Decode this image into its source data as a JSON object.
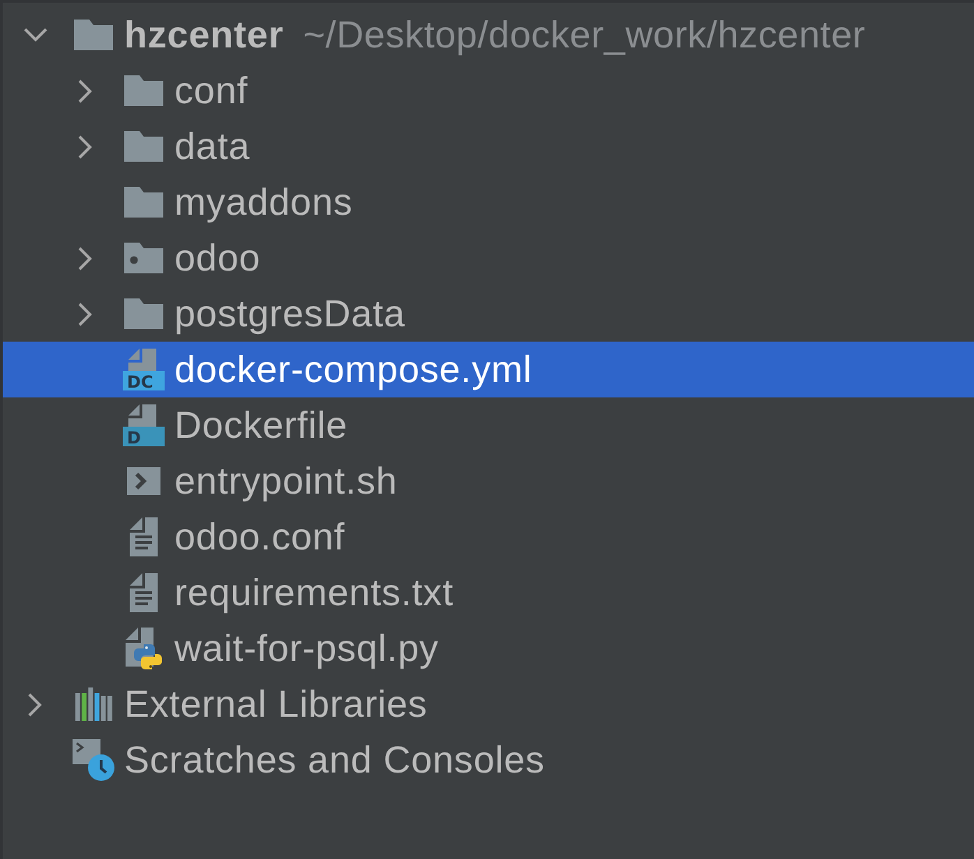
{
  "project_tree": {
    "items": [
      {
        "kind": "project",
        "name": "hzcenter",
        "path": "~/Desktop/docker_work/hzcenter",
        "expanded": true,
        "selected": false,
        "children": [
          {
            "kind": "folder",
            "name": "conf",
            "expanded": false,
            "selected": false
          },
          {
            "kind": "folder",
            "name": "data",
            "expanded": false,
            "selected": false
          },
          {
            "kind": "folder",
            "name": "myaddons",
            "selected": false
          },
          {
            "kind": "module-folder",
            "name": "odoo",
            "expanded": false,
            "selected": false
          },
          {
            "kind": "folder",
            "name": "postgresData",
            "expanded": false,
            "selected": false
          },
          {
            "kind": "compose",
            "name": "docker-compose.yml",
            "icon_text": "DC",
            "selected": true
          },
          {
            "kind": "dockerfile",
            "name": "Dockerfile",
            "icon_text": "D",
            "selected": false
          },
          {
            "kind": "shell",
            "name": "entrypoint.sh",
            "selected": false
          },
          {
            "kind": "text",
            "name": "odoo.conf",
            "selected": false
          },
          {
            "kind": "text",
            "name": "requirements.txt",
            "selected": false
          },
          {
            "kind": "python",
            "name": "wait-for-psql.py",
            "selected": false
          }
        ]
      },
      {
        "kind": "libraries",
        "name": "External Libraries",
        "expanded": false,
        "selected": false
      },
      {
        "kind": "scratches",
        "name": "Scratches and Consoles",
        "selected": false
      }
    ]
  }
}
